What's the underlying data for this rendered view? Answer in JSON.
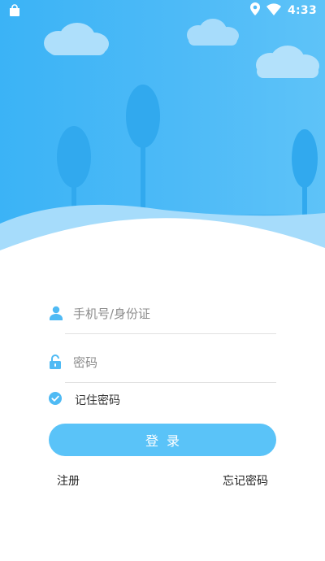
{
  "status_bar": {
    "time": "4:33",
    "icons": [
      "shopping-bag-icon",
      "location-pin-icon",
      "wifi-icon"
    ]
  },
  "header": {
    "illustration": "sky-with-clouds-and-trees",
    "colors": {
      "sky": "#4db9f7",
      "cloud": "#ade1fb",
      "tree": "#30a9ed",
      "wave": "#a6dcfb"
    }
  },
  "login_form": {
    "username": {
      "placeholder": "手机号/身份证",
      "value": "",
      "icon": "user-icon"
    },
    "password": {
      "placeholder": "密码",
      "value": "",
      "icon": "unlock-icon"
    },
    "remember": {
      "label": "记住密码",
      "checked": true,
      "icon": "check-circle-icon"
    },
    "submit_label": "登录",
    "register_label": "注册",
    "forgot_label": "忘记密码"
  },
  "colors": {
    "accent": "#5ac3f8",
    "icon": "#4fbaf4",
    "divider": "#e1e1e1"
  }
}
